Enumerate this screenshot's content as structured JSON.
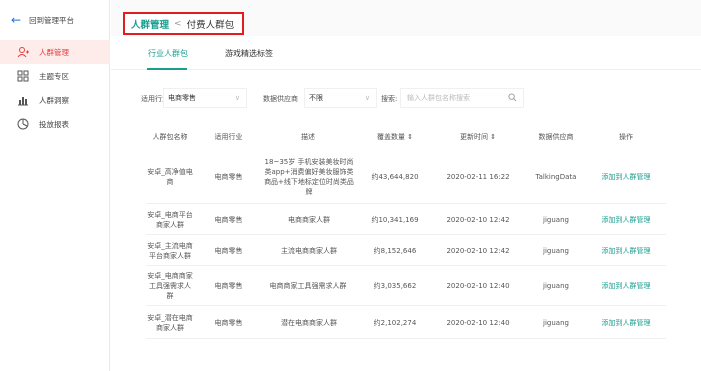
{
  "sidebar": {
    "back_label": "回到管理平台",
    "items": [
      {
        "label": "人群管理",
        "icon": "user-add-icon",
        "active": true
      },
      {
        "label": "主题专区",
        "icon": "grid-icon",
        "active": false
      },
      {
        "label": "人群洞察",
        "icon": "bar-chart-icon",
        "active": false
      },
      {
        "label": "投放报表",
        "icon": "report-icon",
        "active": false
      }
    ]
  },
  "breadcrumb": {
    "parent": "人群管理",
    "separator": "<",
    "current": "付费人群包"
  },
  "tabs": [
    {
      "label": "行业人群包",
      "active": true
    },
    {
      "label": "游戏精选标签",
      "active": false
    }
  ],
  "filters": {
    "industry_label": "适用行业",
    "industry_value": "电商零售",
    "provider_label": "数据供应商",
    "provider_value": "不限",
    "search_label": "搜索:",
    "search_placeholder": "输入人群包名称搜索"
  },
  "table": {
    "headers": [
      "人群包名称",
      "适用行业",
      "描述",
      "覆盖数量 ⇕",
      "更新时间 ⇕",
      "数据供应商",
      "操作"
    ],
    "rows": [
      {
        "name": "安卓_高净值电商",
        "industry": "电商零售",
        "description": "18~35岁 手机安装美妆时尚类app+消费偏好美妆服饰类商品+线下地标定位时尚类品牌",
        "coverage": "约43,644,820",
        "updated": "2020-02-11 16:22",
        "provider": "TalkingData",
        "action": "添加到人群管理"
      },
      {
        "name": "安卓_电商平台商家人群",
        "industry": "电商零售",
        "description": "电商商家人群",
        "coverage": "约10,341,169",
        "updated": "2020-02-10 12:42",
        "provider": "jiguang",
        "action": "添加到人群管理"
      },
      {
        "name": "安卓_主流电商平台商家人群",
        "industry": "电商零售",
        "description": "主流电商商家人群",
        "coverage": "约8,152,646",
        "updated": "2020-02-10 12:42",
        "provider": "jiguang",
        "action": "添加到人群管理"
      },
      {
        "name": "安卓_电商商家工具强需求人群",
        "industry": "电商零售",
        "description": "电商商家工具强需求人群",
        "coverage": "约3,035,662",
        "updated": "2020-02-10 12:40",
        "provider": "jiguang",
        "action": "添加到人群管理"
      },
      {
        "name": "安卓_潜在电商商家人群",
        "industry": "电商零售",
        "description": "潜在电商商家人群",
        "coverage": "约2,102,274",
        "updated": "2020-02-10 12:40",
        "provider": "jiguang",
        "action": "添加到人群管理"
      }
    ]
  }
}
